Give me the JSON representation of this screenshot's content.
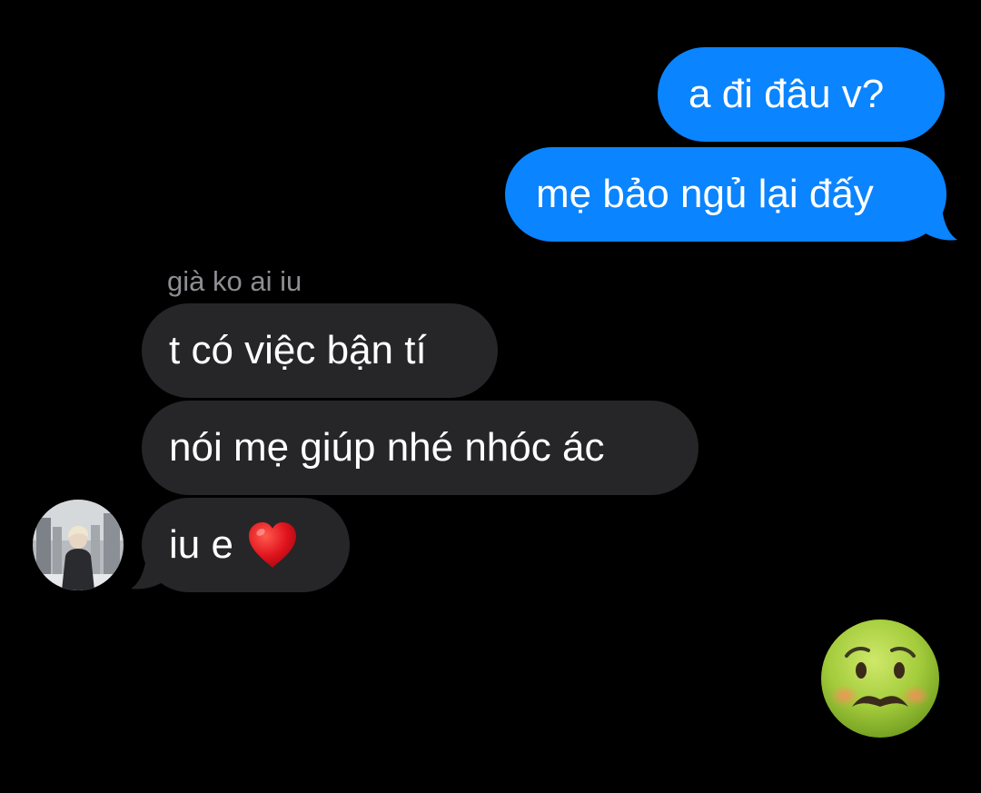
{
  "conversation": {
    "sent_messages": [
      {
        "text": "a đi đâu v?"
      },
      {
        "text": "mẹ bảo ngủ lại đấy"
      }
    ],
    "sender_name": "già ko ai iu",
    "received_messages": [
      {
        "text": "t có việc bận tí"
      },
      {
        "text": "nói mẹ giúp nhé nhóc ác"
      },
      {
        "text": "iu e",
        "emoji": "red-heart"
      }
    ],
    "reaction_emoji": "nauseated-face"
  },
  "colors": {
    "background": "#000000",
    "sent_bubble": "#0A84FF",
    "received_bubble": "#262628",
    "sender_name": "#8E8E93",
    "text": "#FFFFFF"
  }
}
